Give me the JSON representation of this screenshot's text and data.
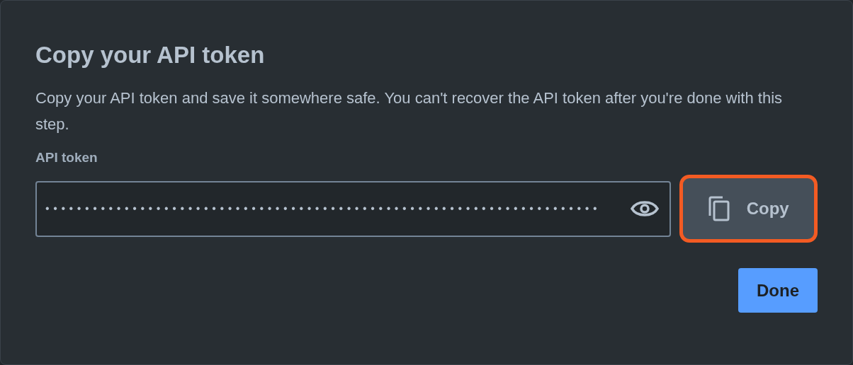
{
  "dialog": {
    "title": "Copy your API token",
    "description": "Copy your API token and save it somewhere safe. You can't recover the API token after you're done with this step.",
    "token_field": {
      "label": "API token",
      "masked_value": "••••••••••••••••••••••••••••••••••••••••••••••••••••••••••••••••••••••",
      "revealed": false
    },
    "copy_button": {
      "label": "Copy",
      "focused": true
    },
    "buttons": [
      {
        "label": "Done",
        "kind": "primary"
      }
    ]
  }
}
